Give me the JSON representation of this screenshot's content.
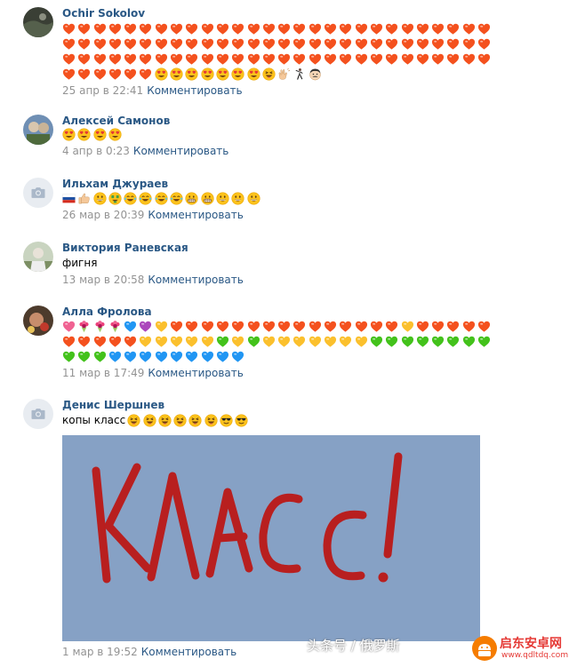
{
  "reply_label": "Комментировать",
  "comments": [
    {
      "author": "Ochir Sokolov",
      "time": "25 апр в 22:41",
      "emoji_rows": [
        [
          "heart-orange",
          "heart-orange",
          "heart-orange",
          "heart-orange",
          "heart-orange",
          "heart-orange",
          "heart-orange",
          "heart-orange",
          "heart-orange",
          "heart-orange",
          "heart-orange",
          "heart-orange",
          "heart-orange",
          "heart-orange",
          "heart-orange",
          "heart-orange",
          "heart-orange",
          "heart-orange",
          "heart-orange",
          "heart-orange",
          "heart-orange",
          "heart-orange",
          "heart-orange",
          "heart-orange",
          "heart-orange",
          "heart-orange",
          "heart-orange",
          "heart-orange"
        ],
        [
          "heart-orange",
          "heart-orange",
          "heart-orange",
          "heart-orange",
          "heart-orange",
          "heart-orange",
          "heart-orange",
          "heart-orange",
          "heart-orange",
          "heart-orange",
          "heart-orange",
          "heart-orange",
          "heart-orange",
          "heart-orange",
          "heart-orange",
          "heart-orange",
          "heart-orange",
          "heart-orange",
          "heart-orange",
          "heart-orange",
          "heart-orange",
          "heart-orange",
          "heart-orange",
          "heart-orange",
          "heart-orange",
          "heart-orange",
          "heart-orange",
          "heart-orange"
        ],
        [
          "heart-orange",
          "heart-orange",
          "heart-orange",
          "heart-orange",
          "heart-orange",
          "heart-orange",
          "heart-orange",
          "heart-orange",
          "heart-orange",
          "heart-orange",
          "heart-orange",
          "heart-orange",
          "heart-orange",
          "heart-orange",
          "heart-orange",
          "heart-orange",
          "heart-orange",
          "heart-orange",
          "heart-orange",
          "heart-orange",
          "heart-orange",
          "heart-orange",
          "heart-orange",
          "heart-orange",
          "heart-orange",
          "heart-orange",
          "heart-orange",
          "heart-orange"
        ],
        [
          "heart-orange",
          "heart-orange",
          "heart-orange",
          "heart-orange",
          "heart-orange",
          "heart-orange",
          "heart-eyes",
          "heart-eyes",
          "heart-eyes",
          "heart-eyes",
          "heart-eyes",
          "heart-eyes",
          "heart-eyes",
          "laughing-face",
          "clapping-hands",
          "dancer",
          "man-face"
        ]
      ]
    },
    {
      "author": "Алексей Самонов",
      "time": "4 апр в 0:23",
      "emoji_rows": [
        [
          "heart-eyes",
          "heart-eyes",
          "heart-eyes",
          "heart-eyes"
        ]
      ]
    },
    {
      "author": "Ильхам Джураев",
      "time": "26 мар в 20:39",
      "emoji_rows": [
        [
          "russia-flag",
          "thumbs-up",
          "grinning-face",
          "money-face",
          "tears-of-joy",
          "tears-of-joy",
          "tears-of-joy",
          "tears-of-joy",
          "grimacing-face",
          "grimacing-face",
          "grinning-face",
          "grinning-face",
          "grinning-face"
        ]
      ]
    },
    {
      "author": "Виктория Раневская",
      "time": "13 мар в 20:58",
      "text": "фигня"
    },
    {
      "author": "Алла Фролова",
      "time": "11 мар в 17:49",
      "emoji_rows": [
        [
          "heart-pink",
          "bouquet",
          "bouquet",
          "bouquet",
          "heart-blue",
          "heart-purple",
          "heart-yellow",
          "heart-orange",
          "heart-orange",
          "heart-orange",
          "heart-orange",
          "heart-orange",
          "heart-orange",
          "heart-orange",
          "heart-orange",
          "heart-orange",
          "heart-orange",
          "heart-orange",
          "heart-orange",
          "heart-orange",
          "heart-orange",
          "heart-orange",
          "heart-yellow",
          "heart-orange",
          "heart-orange",
          "heart-orange",
          "heart-orange",
          "heart-orange"
        ],
        [
          "heart-orange",
          "heart-orange",
          "heart-orange",
          "heart-orange",
          "heart-orange",
          "heart-yellow",
          "heart-yellow",
          "heart-yellow",
          "heart-yellow",
          "heart-yellow",
          "heart-green",
          "heart-yellow",
          "heart-green",
          "heart-yellow",
          "heart-yellow",
          "heart-yellow",
          "heart-yellow",
          "heart-yellow",
          "heart-yellow",
          "heart-yellow",
          "heart-green",
          "heart-green",
          "heart-green",
          "heart-green",
          "heart-green",
          "heart-green",
          "heart-green",
          "heart-green"
        ],
        [
          "heart-green",
          "heart-green",
          "heart-green",
          "heart-blue",
          "heart-blue",
          "heart-blue",
          "heart-blue",
          "heart-blue",
          "heart-blue",
          "heart-blue",
          "heart-blue",
          "heart-blue"
        ]
      ]
    },
    {
      "author": "Денис Шершнев",
      "time": "1 мар в 19:52",
      "text": "копы класс",
      "emoji_rows": [
        [
          "laughing-face",
          "laughing-face",
          "laughing-face",
          "laughing-face",
          "laughing-face",
          "laughing-face",
          "sunglasses-face",
          "sunglasses-face"
        ]
      ],
      "image_text": "КЛАСС!"
    }
  ],
  "watermarks": {
    "left": "头条号 / 俄罗斯",
    "right_title": "启东安卓网",
    "right_url": "www.qdltdq.com"
  },
  "colors": {
    "link": "#2a5885",
    "meta": "#939393",
    "heart_orange": "#f4511e",
    "heart_yellow": "#fbc02d",
    "heart_green": "#43c21b",
    "heart_blue": "#2196f3",
    "heart_purple": "#ab47bc",
    "heart_pink": "#f06292",
    "image_bg": "#8aa5c8",
    "image_ink": "#b81f1f"
  }
}
